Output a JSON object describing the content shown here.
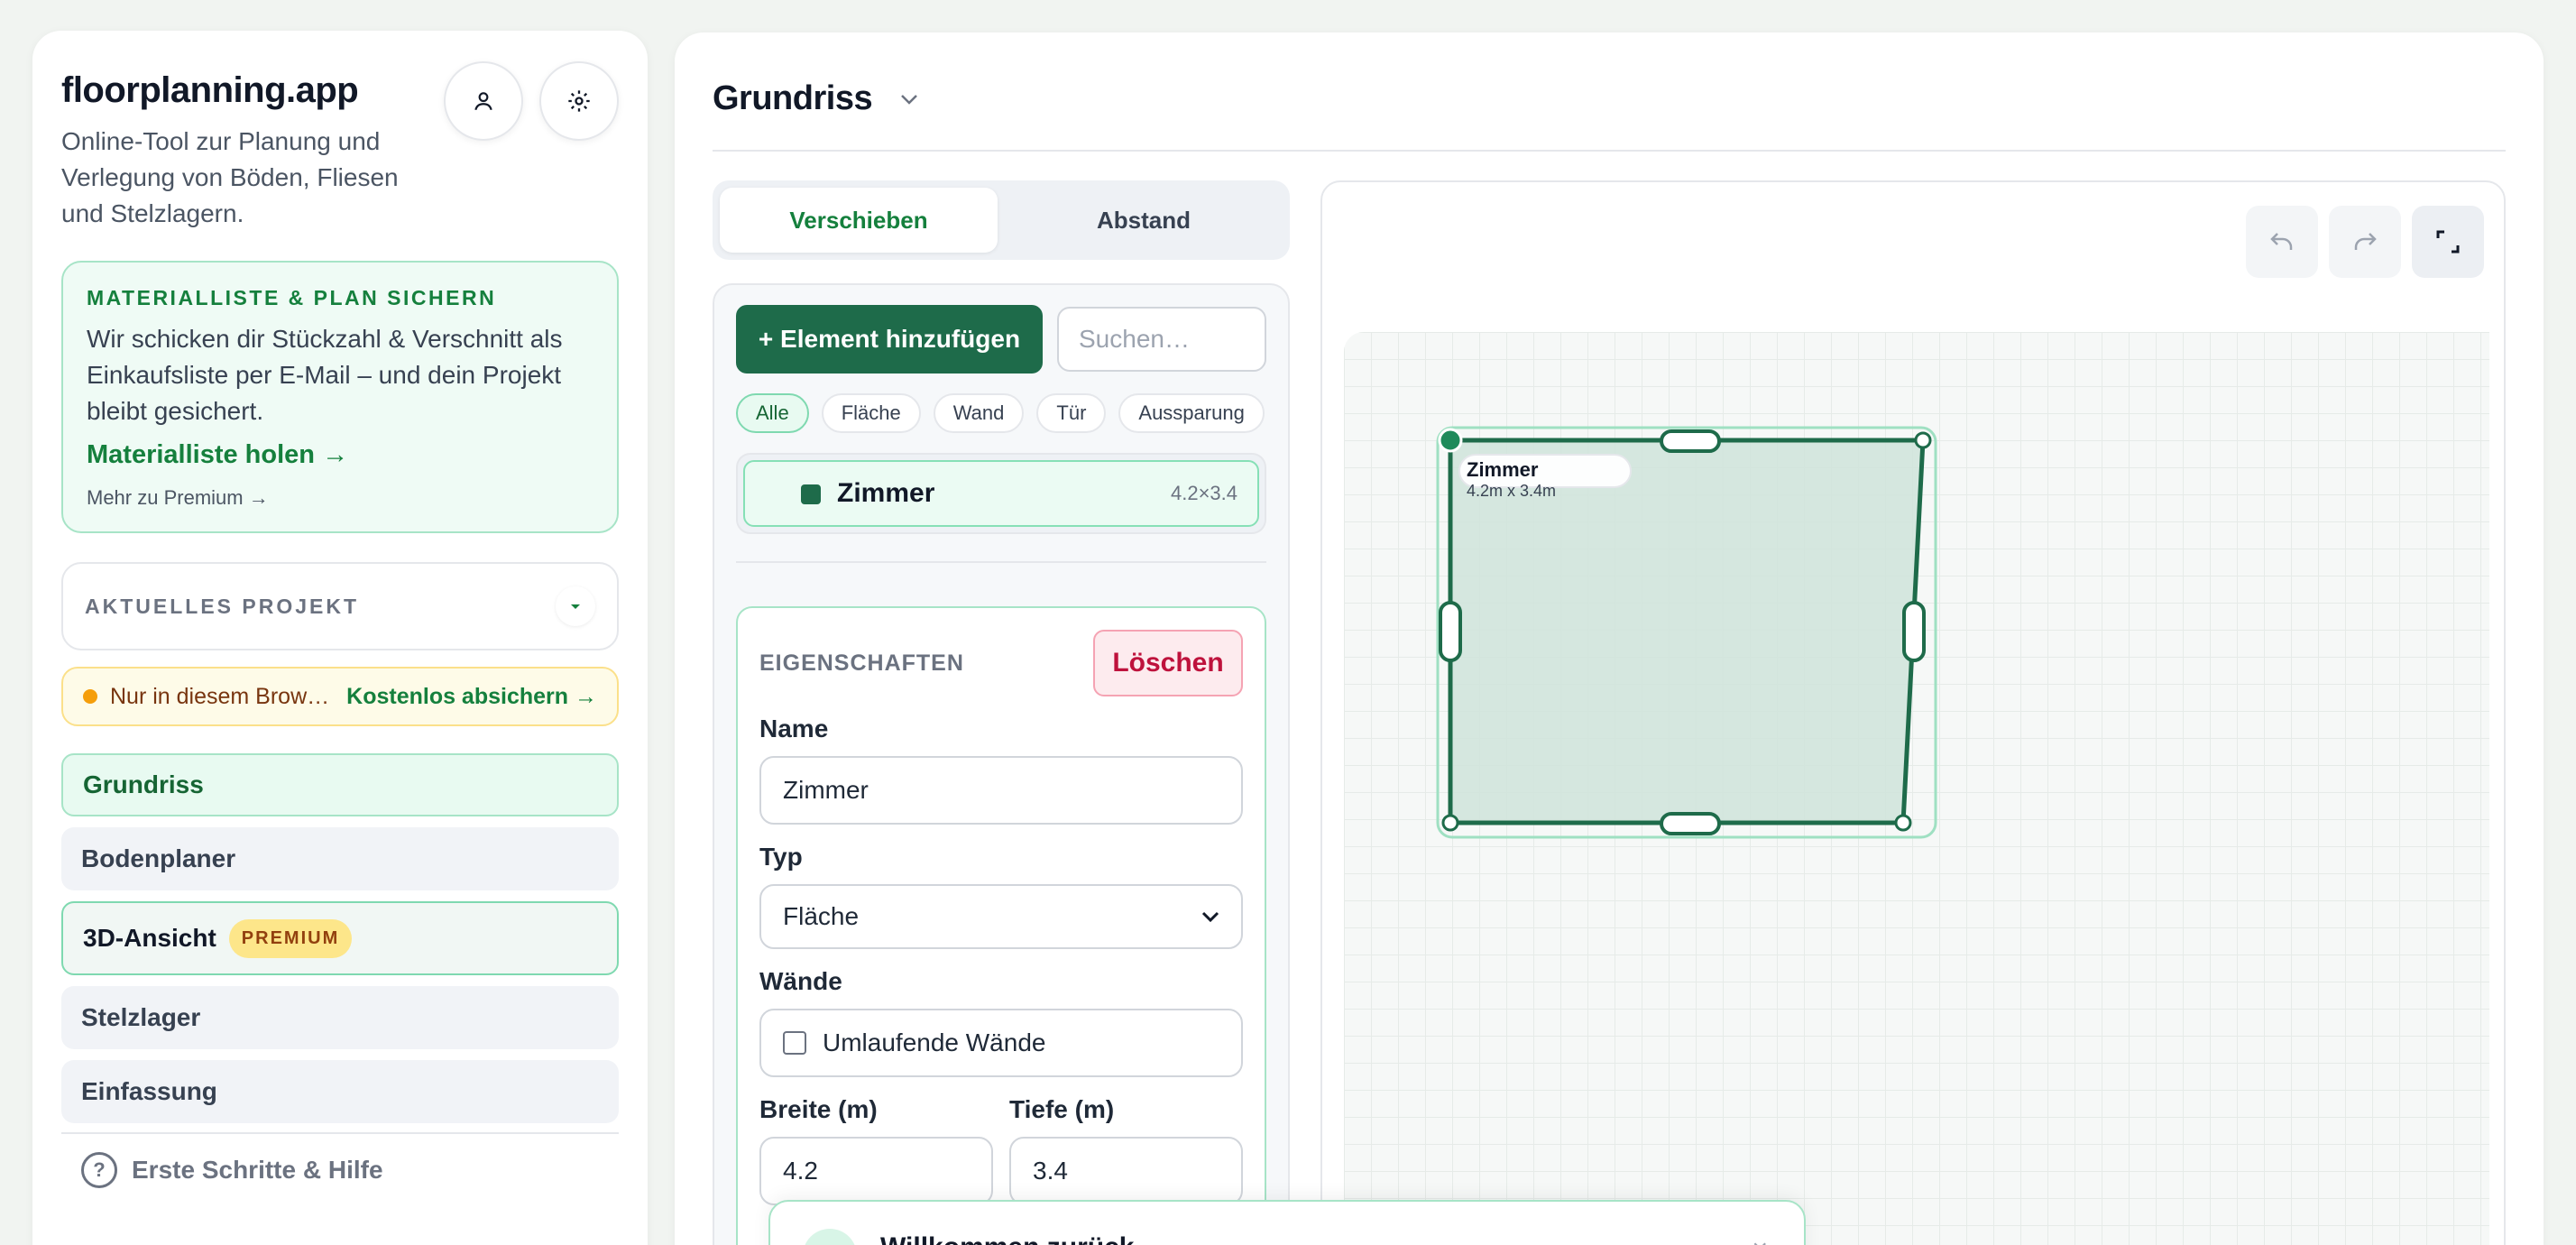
{
  "sidebar": {
    "brand_title": "floorplanning.app",
    "brand_subtitle": "Online-Tool zur Planung und Verlegung von Böden, Fliesen und Stelzlagern.",
    "icons": {
      "account": "user-icon",
      "settings": "gear-icon"
    },
    "promo": {
      "label": "MATERIALLISTE & PLAN SICHERN",
      "text": "Wir schicken dir Stückzahl & Verschnitt als Einkaufsliste per E-Mail – und dein Projekt bleibt gesichert.",
      "link": "Materialliste holen →",
      "more": "Mehr zu Premium →"
    },
    "project": {
      "label": "AKTUELLES PROJEKT"
    },
    "warning": {
      "text": "Nur in diesem Brow…",
      "link": "Kostenlos absichern →"
    },
    "nav": [
      {
        "label": "Grundriss",
        "active": true
      },
      {
        "label": "Bodenplaner"
      },
      {
        "label": "3D-Ansicht",
        "badge": "PREMIUM"
      },
      {
        "label": "Stelzlager"
      },
      {
        "label": "Einfassung"
      }
    ],
    "help": {
      "icon_glyph": "?",
      "label": "Erste Schritte & Hilfe"
    }
  },
  "main": {
    "title": "Grundriss",
    "tabs": [
      {
        "label": "Verschieben",
        "active": true
      },
      {
        "label": "Abstand"
      }
    ],
    "panel": {
      "add_button": "+ Element hinzufügen",
      "search_placeholder": "Suchen…",
      "filters": [
        "Alle",
        "Fläche",
        "Wand",
        "Tür",
        "Aussparung"
      ],
      "active_filter": "Alle",
      "elements": [
        {
          "name": "Zimmer",
          "dims": "4.2×3.4"
        }
      ]
    },
    "properties": {
      "title": "EIGENSCHAFTEN",
      "delete_button": "Löschen",
      "name_label": "Name",
      "name_value": "Zimmer",
      "type_label": "Typ",
      "type_value": "Fläche",
      "walls_label": "Wände",
      "walls_checkbox": "Umlaufende Wände",
      "walls_checked": false,
      "width_label": "Breite (m)",
      "width_value": "4.2",
      "depth_label": "Tiefe (m)",
      "depth_value": "3.4"
    },
    "canvas": {
      "toolbar": [
        "undo-icon",
        "redo-icon",
        "fullscreen-icon"
      ],
      "room_label": "Zimmer",
      "room_dims": "4.2m x 3.4m",
      "room_color": "#1e6b4a",
      "room_fill": "#cfe4da"
    }
  },
  "toast": {
    "title": "Willkommen zurück",
    "close_glyph": "×"
  }
}
